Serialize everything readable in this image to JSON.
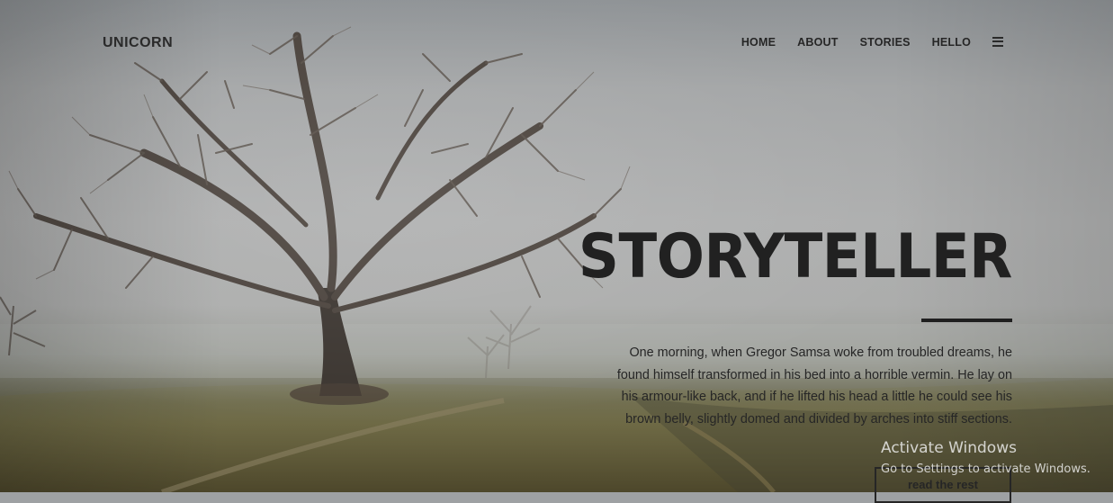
{
  "header": {
    "logo": "UNICORN",
    "nav": [
      {
        "label": "HOME"
      },
      {
        "label": "ABOUT"
      },
      {
        "label": "STORIES"
      },
      {
        "label": "HELLO"
      }
    ],
    "menu_icon": "hamburger-menu-icon"
  },
  "hero": {
    "title": "STORYTELLER",
    "text": "One morning, when Gregor Samsa woke from troubled dreams, he found himself transformed in his bed into a horrible vermin. He lay on his armour-like back, and if he lifted his head a little he could see his brown belly, slightly domed and divided by arches into stiff sections.",
    "button_label": "read the rest",
    "background_image": "foggy-tree-landscape"
  },
  "watermark": {
    "title": "Activate Windows",
    "subtitle": "Go to Settings to activate Windows."
  },
  "colors": {
    "text_dark": "#212121",
    "fog": "#aeafaf",
    "grass": "#5b5637"
  }
}
